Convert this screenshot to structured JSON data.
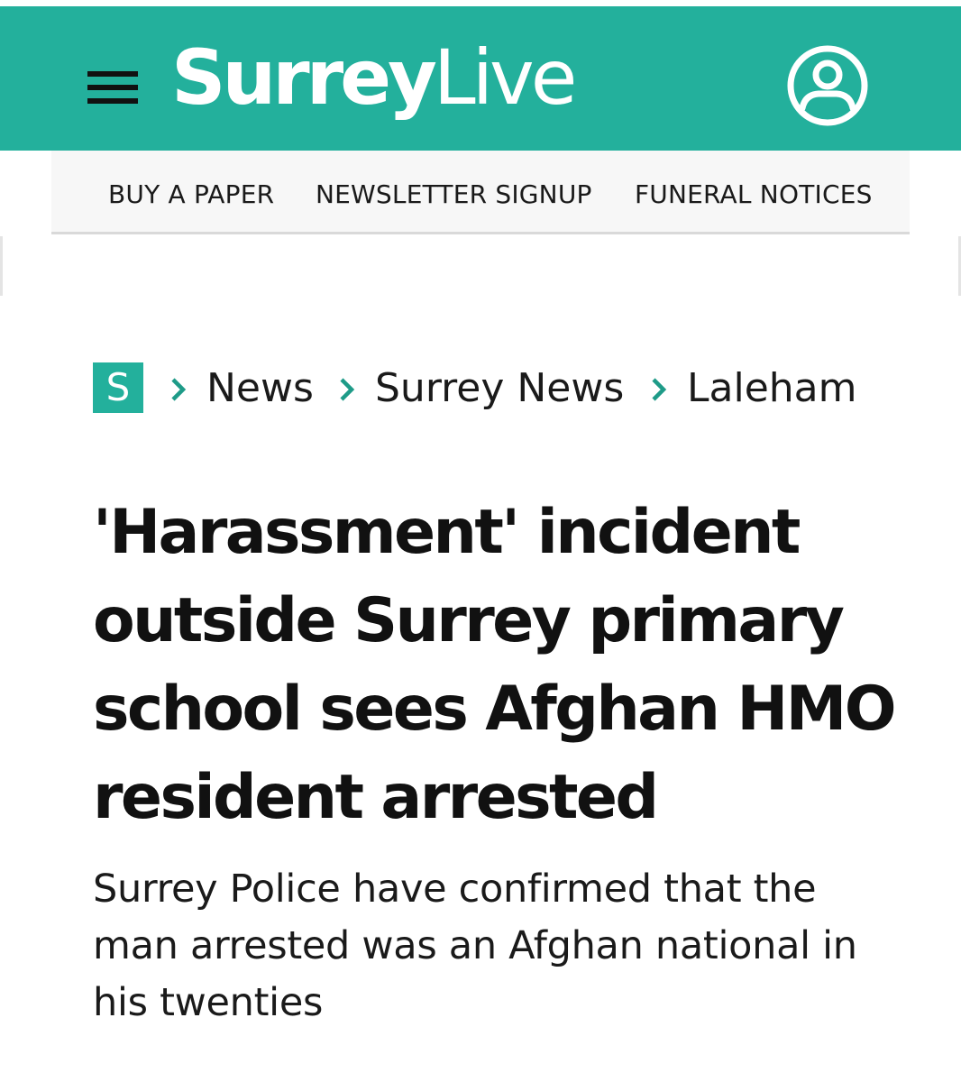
{
  "header": {
    "logo_bold": "Surrey",
    "logo_light": "Live",
    "menu_icon": "hamburger-menu-icon",
    "account_icon": "user-account-icon",
    "brand_color": "#23b09c"
  },
  "subnav": {
    "items": [
      {
        "label": "BUY A PAPER"
      },
      {
        "label": "NEWSLETTER SIGNUP"
      },
      {
        "label": "FUNERAL NOTICES"
      }
    ]
  },
  "breadcrumb": {
    "home_badge": "S",
    "separator_icon": "chevron-right-icon",
    "items": [
      {
        "label": "News"
      },
      {
        "label": "Surrey News"
      },
      {
        "label": "Laleham"
      }
    ]
  },
  "article": {
    "headline": "'Harassment' incident outside Surrey primary school sees Afghan HMO resident arrested",
    "standfirst": "Surrey Police have confirmed that the man arrested was an Afghan national in his twenties"
  }
}
